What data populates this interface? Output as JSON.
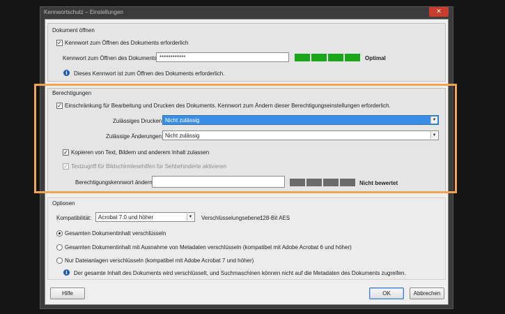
{
  "window": {
    "title": "Kennwortschutz – Einstellungen",
    "close_glyph": "✕"
  },
  "open_section": {
    "title": "Dokument öffnen",
    "require_password_label": "Kennwort zum Öffnen des Dokuments erforderlich",
    "require_password_checked": true,
    "password_label": "Kennwort zum Öffnen des Dokuments:",
    "password_value": "************",
    "strength_label": "Optimal",
    "strength_level": 4,
    "strength_max": 4,
    "strength_color": "#1aa51a",
    "info_text": "Dieses Kennwort ist zum Öffnen des Dokuments erforderlich."
  },
  "permissions_section": {
    "title": "Berechtigungen",
    "restrict_label": "Einschränkung für Bearbeitung und Drucken des Dokuments. Kennwort zum Ändern dieser Berechtigungseinstellungen erforderlich.",
    "restrict_checked": true,
    "printing_label": "Zulässiges Drucken:",
    "printing_value": "Nicht zulässig",
    "changes_label": "Zulässige Änderungen:",
    "changes_value": "Nicht zulässig",
    "copy_label": "Kopieren von Text, Bildern und anderem Inhalt zulassen",
    "copy_checked": true,
    "screenreader_label": "Textzugriff für Bildschirmlesehilfen für Sehbehinderte aktivieren",
    "screenreader_checked": true,
    "perm_password_label": "Berechtigungskennwort ändern:",
    "perm_password_value": "",
    "strength_label": "Nicht bewertet",
    "strength_color": "#6b6b6b"
  },
  "options_section": {
    "title": "Optionen",
    "compat_label": "Kompatibilität:",
    "compat_value": "Acrobat 7.0 und höher",
    "encryption_label": "Verschlüsselungsebene:",
    "encryption_value": "128-Bit AES",
    "radio_all": "Gesamten Dokumentinhalt verschlüsseln",
    "radio_except_meta": "Gesamten Dokumentinhalt mit Ausnahme von Metadaten verschlüsseln (kompatibel mit Adobe Acrobat 6 und höher)",
    "radio_attachments": "Nur Dateianlagen verschlüsseln (kompatibel mit Adobe Acrobat 7 und höher)",
    "selected_radio": "all",
    "info_text": "Der gesamte Inhalt des Dokuments wird verschlüsselt, und Suchmaschinen können nicht auf die Metadaten des Dokuments zugreifen."
  },
  "buttons": {
    "help": "Hilfe",
    "ok": "OK",
    "cancel": "Abbrechen"
  },
  "colors": {
    "highlight_outline": "#f4a34e",
    "select_highlight": "#3a8ee6"
  }
}
